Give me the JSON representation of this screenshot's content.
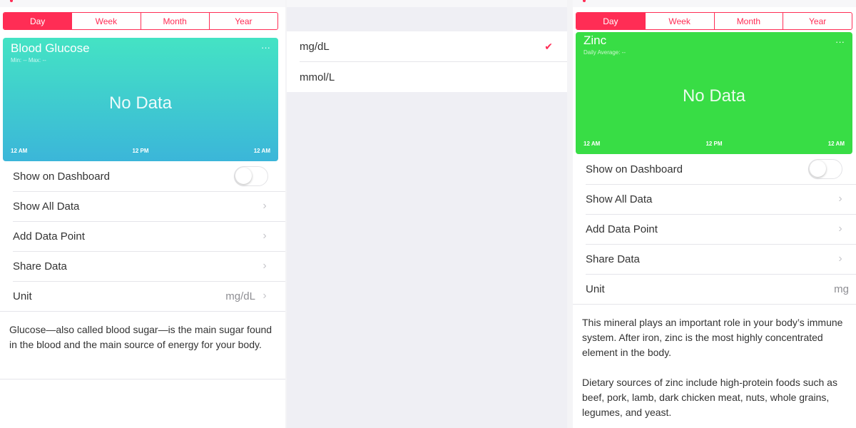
{
  "colors": {
    "accent": "#ff2d55",
    "glucose_card_top": "#44e3c4",
    "glucose_card_bottom": "#3bb6d9",
    "zinc_card": "#38dd45"
  },
  "left": {
    "segments": [
      "Day",
      "Week",
      "Month",
      "Year"
    ],
    "active_segment": "Day",
    "card": {
      "title": "Blood Glucose",
      "subtitle": "Min: -- Max: --",
      "more": "···",
      "empty_text": "No Data",
      "ticks": [
        "12 AM",
        "12 PM",
        "12 AM"
      ]
    },
    "rows": {
      "show_on_dashboard": "Show on Dashboard",
      "show_all_data": "Show All Data",
      "add_data_point": "Add Data Point",
      "share_data": "Share Data",
      "unit": "Unit",
      "unit_value": "mg/dL"
    },
    "description": "Glucose—also called blood sugar—is the main sugar found in the blood and the main source of energy for your body."
  },
  "middle": {
    "units": [
      {
        "label": "mg/dL",
        "selected": true
      },
      {
        "label": "mmol/L",
        "selected": false
      }
    ],
    "check_icon": "checkmark-icon"
  },
  "right": {
    "segments": [
      "Day",
      "Week",
      "Month",
      "Year"
    ],
    "active_segment": "Day",
    "card": {
      "title": "Zinc",
      "subtitle": "Daily Average: --",
      "more": "···",
      "empty_text": "No Data",
      "ticks": [
        "12 AM",
        "12 PM",
        "12 AM"
      ]
    },
    "rows": {
      "show_on_dashboard": "Show on Dashboard",
      "show_all_data": "Show All Data",
      "add_data_point": "Add Data Point",
      "share_data": "Share Data",
      "unit": "Unit",
      "unit_value": "mg"
    },
    "description_1": "This mineral plays an important role in your body’s immune system. After iron, zinc is the most highly concentrated element in the body.",
    "description_2": "Dietary sources of zinc include high-protein foods such as beef, pork, lamb, dark chicken meat, nuts, whole grains, legumes, and yeast."
  }
}
